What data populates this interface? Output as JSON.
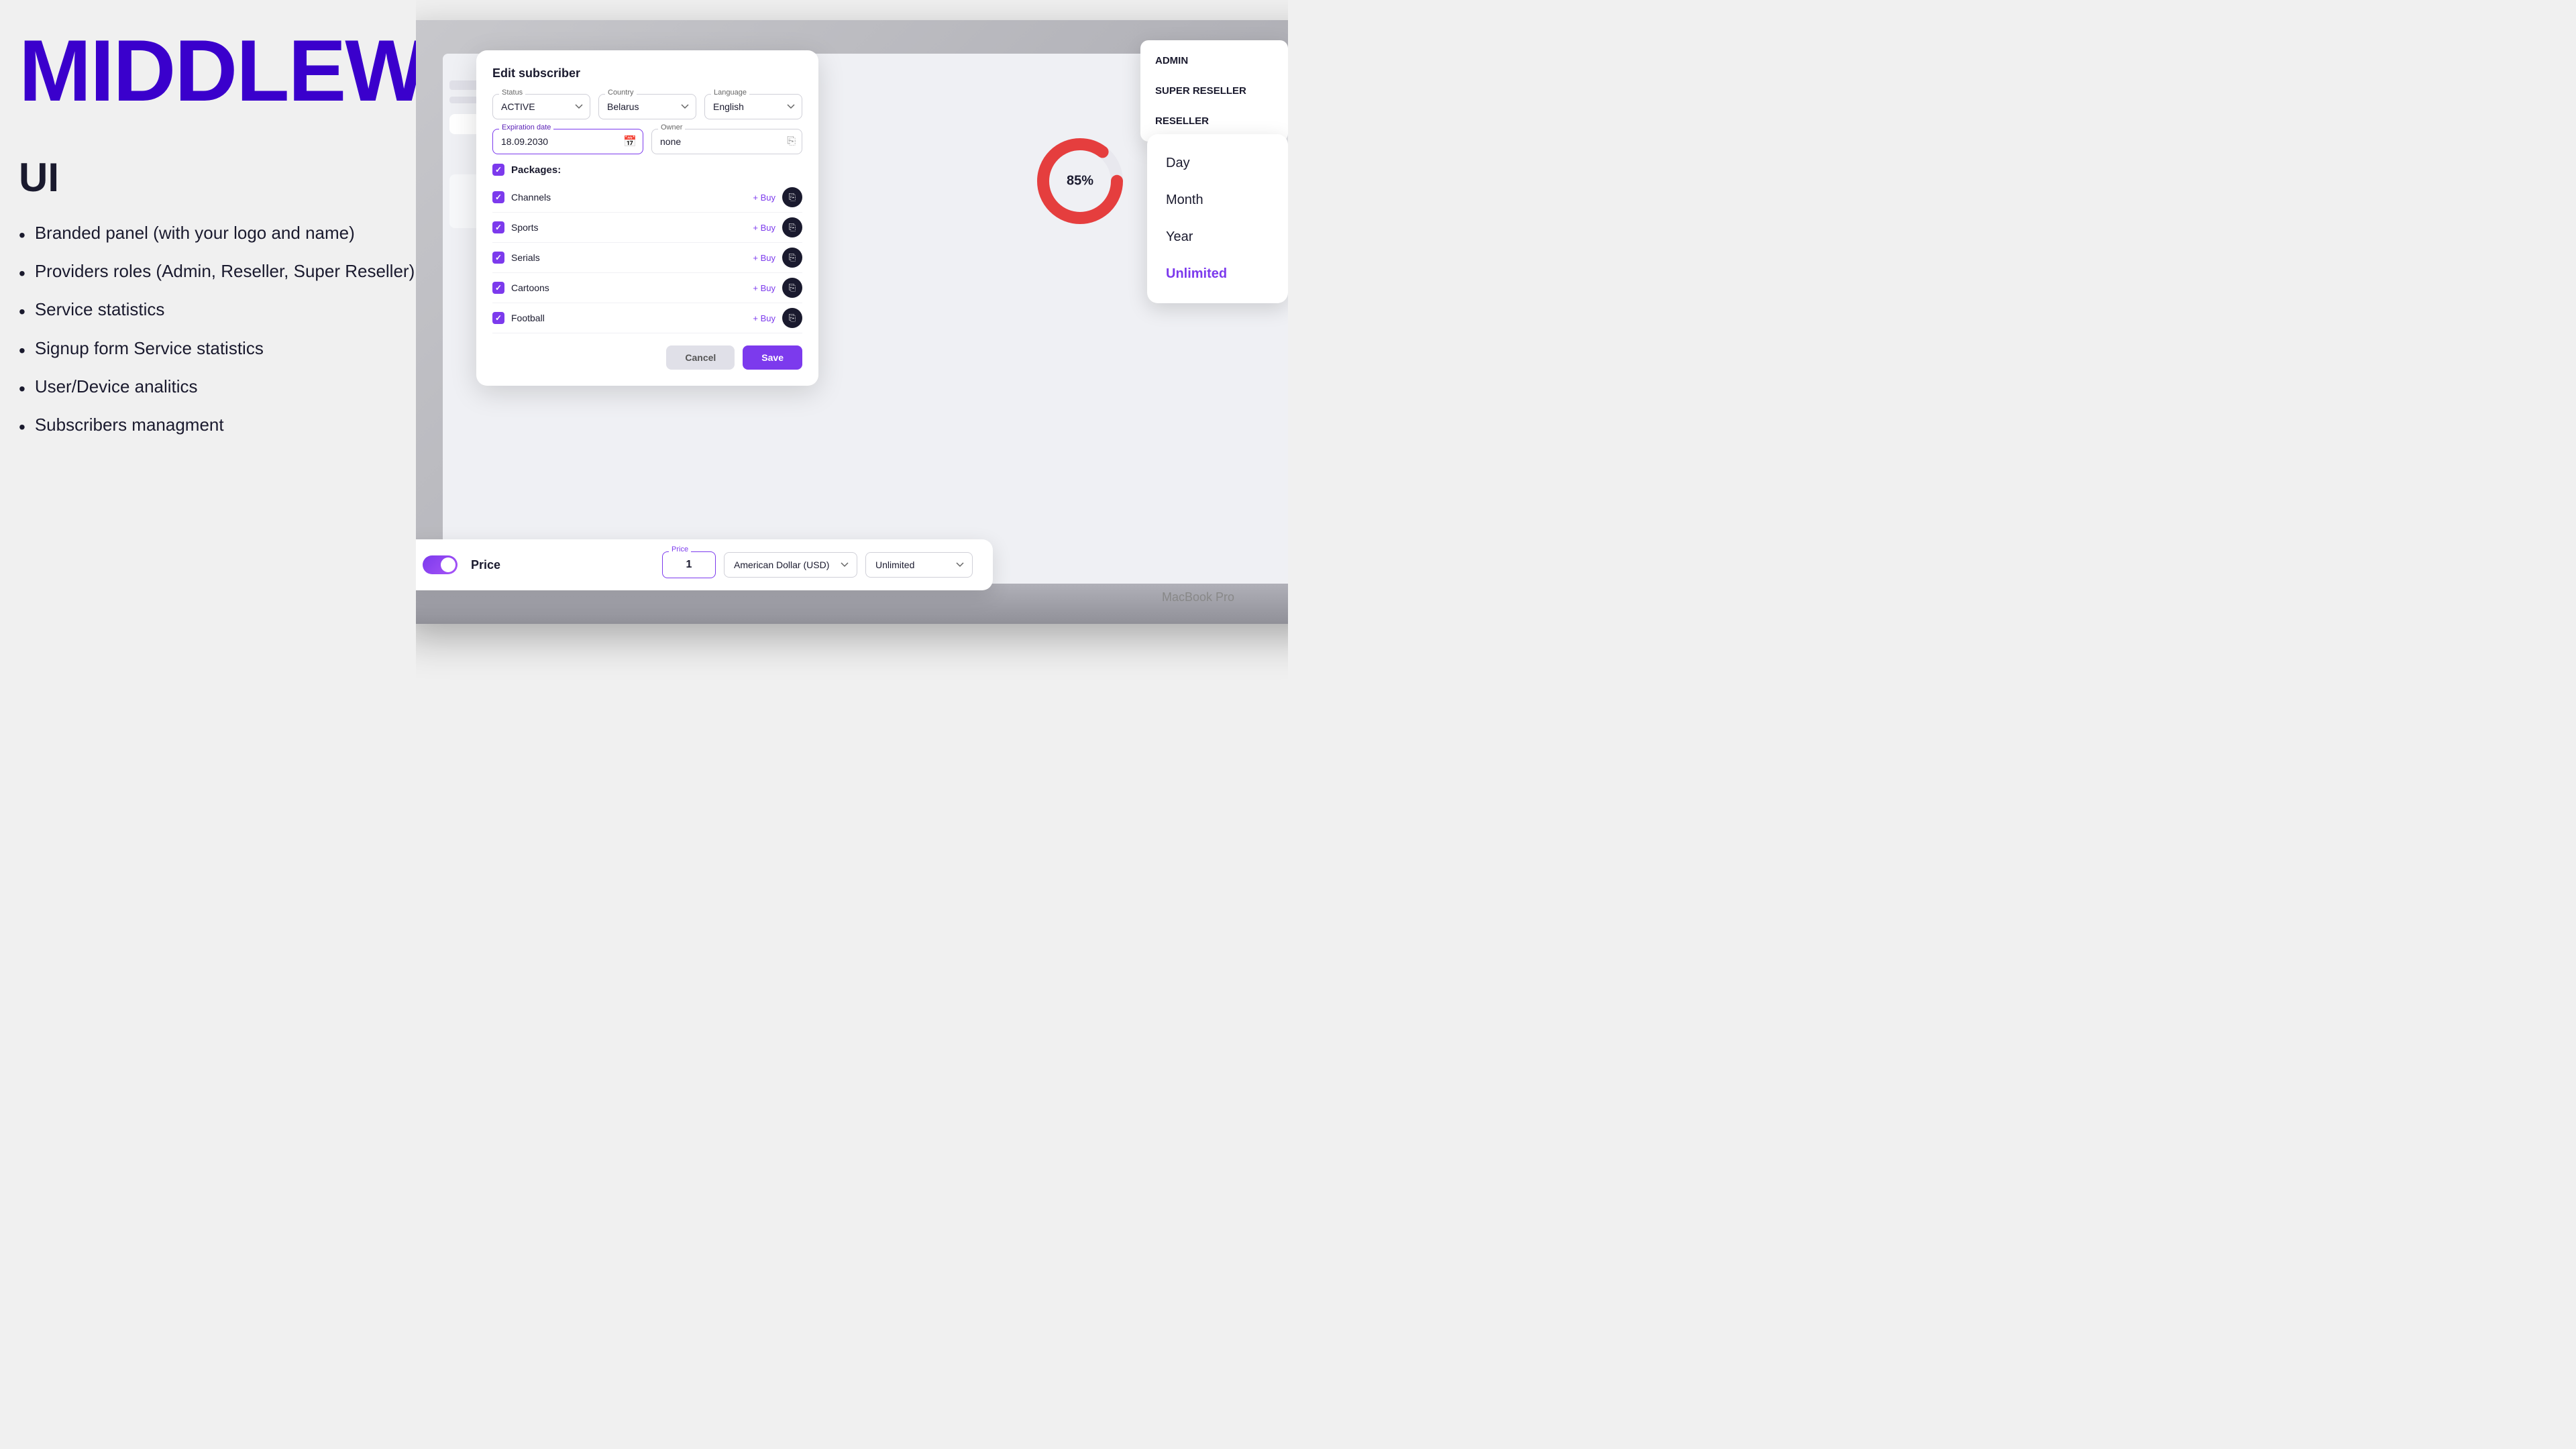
{
  "page": {
    "background_color": "#f0f0f0"
  },
  "left": {
    "main_title": "MIDDLEWARE",
    "subtitle": "UI",
    "features": [
      "Branded panel (with your logo and name)",
      "Providers roles (Admin, Reseller, Super Reseller)",
      "Service statistics",
      "Signup form Service statistics",
      "User/Device analitics",
      "Subscribers managment"
    ]
  },
  "modal": {
    "title": "Edit subscriber",
    "status_label": "Status",
    "status_value": "ACTIVE",
    "country_label": "Country",
    "country_value": "Belarus",
    "language_label": "Language",
    "language_value": "English",
    "expiration_label": "Expiration date",
    "expiration_value": "18.09.2030",
    "owner_label": "Owner",
    "owner_value": "none",
    "packages_label": "Packages:",
    "packages": [
      {
        "name": "Channels",
        "buy": "+ Buy"
      },
      {
        "name": "Sports",
        "buy": "+ Buy"
      },
      {
        "name": "Serials",
        "buy": "+ Buy"
      },
      {
        "name": "Cartoons",
        "buy": "+ Buy"
      },
      {
        "name": "Football",
        "buy": "+ Buy"
      }
    ],
    "cancel_label": "Cancel",
    "save_label": "Save"
  },
  "role_dropdown": {
    "items": [
      "ADMIN",
      "SUPER RESELLER",
      "RESELLER"
    ]
  },
  "date_dropdown": {
    "items": [
      "Day",
      "Month",
      "Year",
      "Unlimited"
    ],
    "active": "Unlimited"
  },
  "price_bar": {
    "toggle_label": "Price",
    "price_label": "Price",
    "price_value": "1",
    "currency_label": "American Dollar (USD)",
    "period_label": "Unlimited"
  },
  "laptop": {
    "brand": "MacBook Pro"
  },
  "dashboard": {
    "donut_percent": "85%"
  }
}
